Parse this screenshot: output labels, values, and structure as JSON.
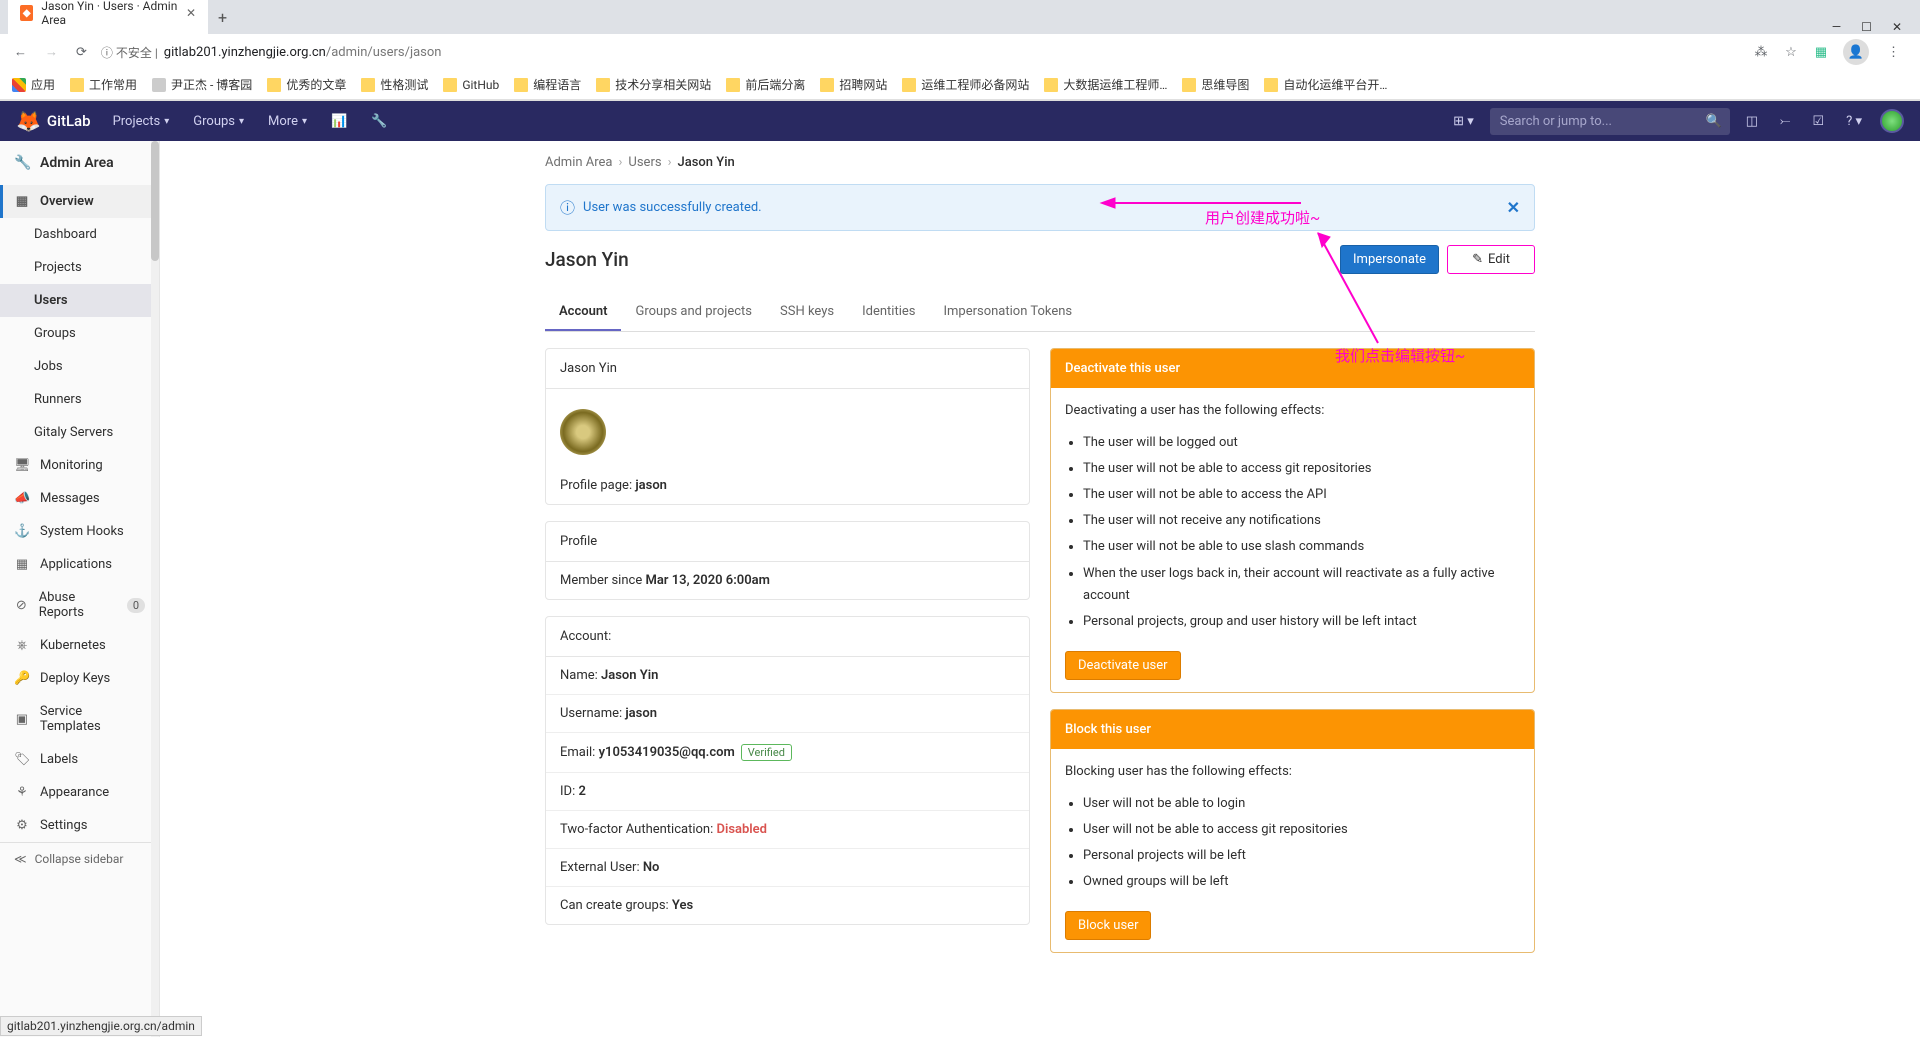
{
  "browser": {
    "tab_title": "Jason Yin · Users · Admin Area",
    "insecure_label": "ⓘ 不安全 |",
    "url_host": "gitlab201.yinzhengjie.org.cn",
    "url_path": "/admin/users/jason",
    "window_min": "—",
    "window_max": "☐",
    "window_close": "✕",
    "bookmarks": {
      "apps": "应用",
      "items": [
        "工作常用",
        "尹正杰 - 博客园",
        "优秀的文章",
        "性格测试",
        "GitHub",
        "编程语言",
        "技术分享相关网站",
        "前后端分离",
        "招聘网站",
        "运维工程师必备网站",
        "大数据运维工程师…",
        "思维导图",
        "自动化运维平台开…"
      ]
    }
  },
  "topbar": {
    "brand": "GitLab",
    "menu": {
      "projects": "Projects",
      "groups": "Groups",
      "more": "More"
    },
    "search_placeholder": "Search or jump to..."
  },
  "sidebar": {
    "header": "Admin Area",
    "overview": "Overview",
    "sub": {
      "dashboard": "Dashboard",
      "projects": "Projects",
      "users": "Users",
      "groups": "Groups",
      "jobs": "Jobs",
      "runners": "Runners",
      "gitaly": "Gitaly Servers"
    },
    "monitoring": "Monitoring",
    "messages": "Messages",
    "system_hooks": "System Hooks",
    "applications": "Applications",
    "abuse_reports": "Abuse Reports",
    "abuse_count": "0",
    "kubernetes": "Kubernetes",
    "deploy_keys": "Deploy Keys",
    "service_templates": "Service Templates",
    "labels": "Labels",
    "appearance": "Appearance",
    "settings": "Settings",
    "collapse": "Collapse sidebar"
  },
  "crumbs": {
    "admin": "Admin Area",
    "users": "Users",
    "current": "Jason Yin"
  },
  "alert": {
    "text": "User was successfully created.",
    "close": "✕"
  },
  "header": {
    "title": "Jason Yin",
    "impersonate": "Impersonate",
    "edit": "Edit"
  },
  "tabs": {
    "account": "Account",
    "groups": "Groups and projects",
    "ssh": "SSH keys",
    "identities": "Identities",
    "tokens": "Impersonation Tokens"
  },
  "profile": {
    "name": "Jason Yin",
    "profile_page_label": "Profile page: ",
    "profile_page_value": "jason",
    "section_label": "Profile",
    "member_since_label": "Member since ",
    "member_since_value": "Mar 13, 2020 6:00am",
    "account_label": "Account:",
    "name_label": "Name: ",
    "name_value": "Jason Yin",
    "username_label": "Username: ",
    "username_value": "jason",
    "email_label": "Email: ",
    "email_value": "y1053419035@qq.com",
    "verified": "Verified",
    "id_label": "ID: ",
    "id_value": "2",
    "twofa_label": "Two-factor Authentication: ",
    "twofa_value": "Disabled",
    "external_label": "External User: ",
    "external_value": "No",
    "create_groups_label": "Can create groups: ",
    "create_groups_value": "Yes"
  },
  "deactivate": {
    "title": "Deactivate this user",
    "lead": "Deactivating a user has the following effects:",
    "items": [
      "The user will be logged out",
      "The user will not be able to access git repositories",
      "The user will not be able to access the API",
      "The user will not receive any notifications",
      "The user will not be able to use slash commands",
      "When the user logs back in, their account will reactivate as a fully active account",
      "Personal projects, group and user history will be left intact"
    ],
    "button": "Deactivate user"
  },
  "block": {
    "title": "Block this user",
    "lead": "Blocking user has the following effects:",
    "items": [
      "User will not be able to login",
      "User will not be able to access git repositories",
      "Personal projects will be left",
      "Owned groups will be left"
    ],
    "button": "Block user"
  },
  "annotations": {
    "created_ok": "用户创建成功啦~",
    "click_edit": "我们点击编辑按钮~"
  },
  "status_bar": "gitlab201.yinzhengjie.org.cn/admin"
}
